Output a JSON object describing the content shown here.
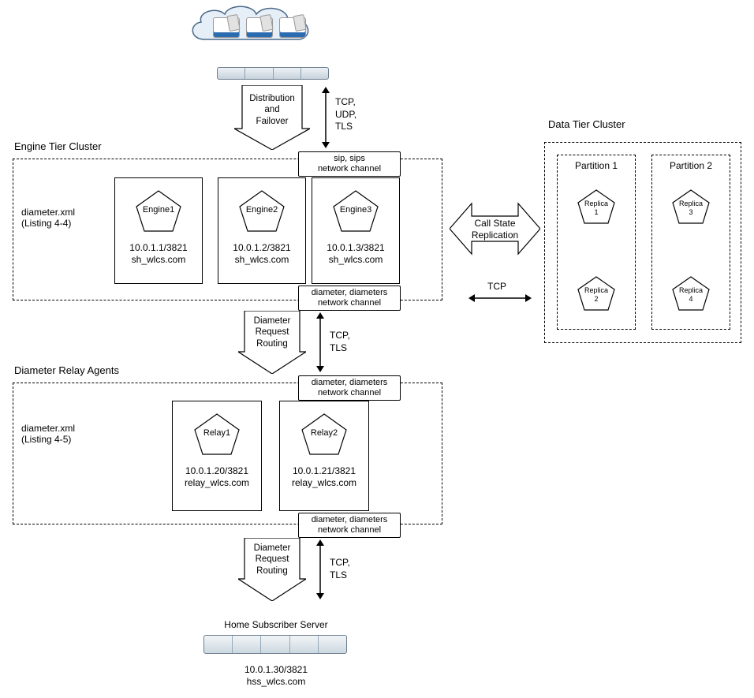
{
  "top": {
    "arrow1_label": "Distribution\nand\nFailover",
    "protocols1": "TCP,\nUDP,\nTLS"
  },
  "engine_cluster": {
    "title": "Engine Tier Cluster",
    "config": "diameter.xml\n(Listing 4-4)",
    "channel_top": "sip, sips\nnetwork channel",
    "channel_bottom": "diameter, diameters\nnetwork channel",
    "nodes": [
      {
        "name": "Engine1",
        "addr": "10.0.1.1/3821\nsh_wlcs.com"
      },
      {
        "name": "Engine2",
        "addr": "10.0.1.2/3821\nsh_wlcs.com"
      },
      {
        "name": "Engine3",
        "addr": "10.0.1.3/3821\nsh_wlcs.com"
      }
    ]
  },
  "call_state": {
    "label": "Call State\nReplication",
    "tcp": "TCP"
  },
  "data_tier": {
    "title": "Data Tier Cluster",
    "partitions": [
      {
        "title": "Partition 1",
        "replicas": [
          "Replica\n1",
          "Replica\n2"
        ]
      },
      {
        "title": "Partition 2",
        "replicas": [
          "Replica\n3",
          "Replica\n4"
        ]
      }
    ]
  },
  "mid": {
    "arrow_label": "Diameter\nRequest\nRouting",
    "protocols": "TCP,\nTLS"
  },
  "relay_cluster": {
    "title": "Diameter Relay Agents",
    "config": "diameter.xml\n(Listing 4-5)",
    "channel_top": "diameter, diameters\nnetwork channel",
    "channel_bottom": "diameter, diameters\nnetwork channel",
    "nodes": [
      {
        "name": "Relay1",
        "addr": "10.0.1.20/3821\nrelay_wlcs.com"
      },
      {
        "name": "Relay2",
        "addr": "10.0.1.21/3821\nrelay_wlcs.com"
      }
    ]
  },
  "bottom": {
    "arrow_label": "Diameter\nRequest\nRouting",
    "protocols": "TCP,\nTLS",
    "hss_title": "Home Subscriber Server",
    "hss_addr": "10.0.1.30/3821\nhss_wlcs.com"
  }
}
